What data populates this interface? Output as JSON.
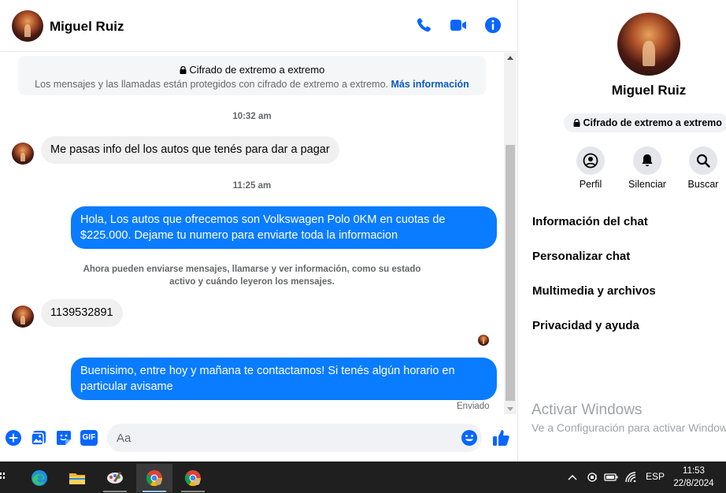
{
  "header": {
    "contact_name": "Miguel Ruiz"
  },
  "encryption_card": {
    "title": "Cifrado de extremo a extremo",
    "text": "Los mensajes y las llamadas están protegidos con cifrado de extremo a extremo.",
    "link": "Más información"
  },
  "messages": {
    "time_1": "10:32 am",
    "incoming_1": "Me pasas info del los autos que tenés para dar a pagar",
    "time_2": "11:25 am",
    "outgoing_1_line1": "Hola, Los autos que ofrecemos son Volkswagen Polo 0KM en cuotas de",
    "outgoing_1_line2": "$225.000. Dejame tu numero para enviarte toda la informacion",
    "notice_line1": "Ahora pueden enviarse mensajes, llamarse y ver información, como su estado",
    "notice_line2": "activo y cuándo leyeron los mensajes.",
    "incoming_2": "1139532891",
    "outgoing_2_line1": "Buenisimo, entre hoy y mañana te contactamos! Si tenés algún horario en",
    "outgoing_2_line2": "particular avisame",
    "sent_status": "Enviado"
  },
  "composer": {
    "placeholder": "Aa",
    "gif_label": "GIF"
  },
  "info_panel": {
    "name": "Miguel Ruiz",
    "e2e_badge": "Cifrado de extremo a extremo",
    "actions": {
      "profile": "Perfil",
      "mute": "Silenciar",
      "search": "Buscar"
    },
    "menu": {
      "chat_info": "Información del chat",
      "customize": "Personalizar chat",
      "media": "Multimedia y archivos",
      "privacy": "Privacidad y ayuda"
    }
  },
  "watermark": {
    "title": "Activar Windows",
    "subtitle": "Ve a Configuración para activar Windows."
  },
  "taskbar": {
    "language": "ESP",
    "time": "11:53",
    "date": "22/8/2024"
  },
  "colors": {
    "messenger_blue": "#0a7cff",
    "icon_blue": "#0866ff",
    "incoming_bubble": "#f0f0f0",
    "taskbar": "#1f1f1f"
  }
}
